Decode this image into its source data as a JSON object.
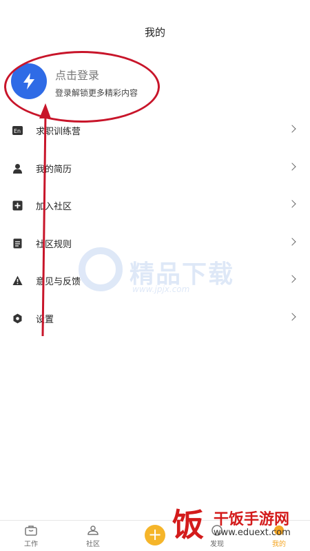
{
  "header": {
    "title": "我的"
  },
  "login": {
    "title": "点击登录",
    "subtitle": "登录解锁更多精彩内容"
  },
  "menu": [
    {
      "label": "求职训练营",
      "icon": "en-badge-icon"
    },
    {
      "label": "我的简历",
      "icon": "person-icon"
    },
    {
      "label": "加入社区",
      "icon": "plus-square-icon"
    },
    {
      "label": "社区规则",
      "icon": "document-icon"
    },
    {
      "label": "意见与反馈",
      "icon": "warning-icon"
    },
    {
      "label": "设置",
      "icon": "hexagon-gear-icon"
    }
  ],
  "tabbar": {
    "work": "工作",
    "community": "社区",
    "discover": "发现",
    "mine": "我的"
  },
  "watermark": {
    "text": "精品下载",
    "url": "www.jpjx.com"
  },
  "site_logo": {
    "glyph": "饭",
    "name": "干饭手游网",
    "url": "www.eduext.com"
  },
  "colors": {
    "accent": "#2f6be6",
    "annotation": "#c8152a",
    "tab_active": "#f5a623"
  }
}
